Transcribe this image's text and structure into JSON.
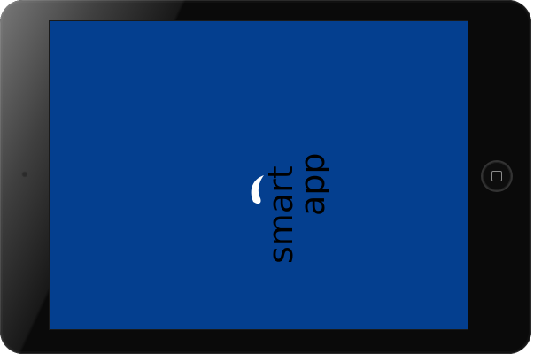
{
  "app": {
    "logo_word_left": "smart",
    "logo_word_right": "app"
  },
  "colors": {
    "screen_background": "#043f8f",
    "bezel": "#0a0a0a",
    "logo": "#000000",
    "leaf": "#ffffff"
  },
  "icons": {
    "logo_leaf": "leaf-icon",
    "home": "home-button-icon",
    "camera": "camera-icon"
  }
}
